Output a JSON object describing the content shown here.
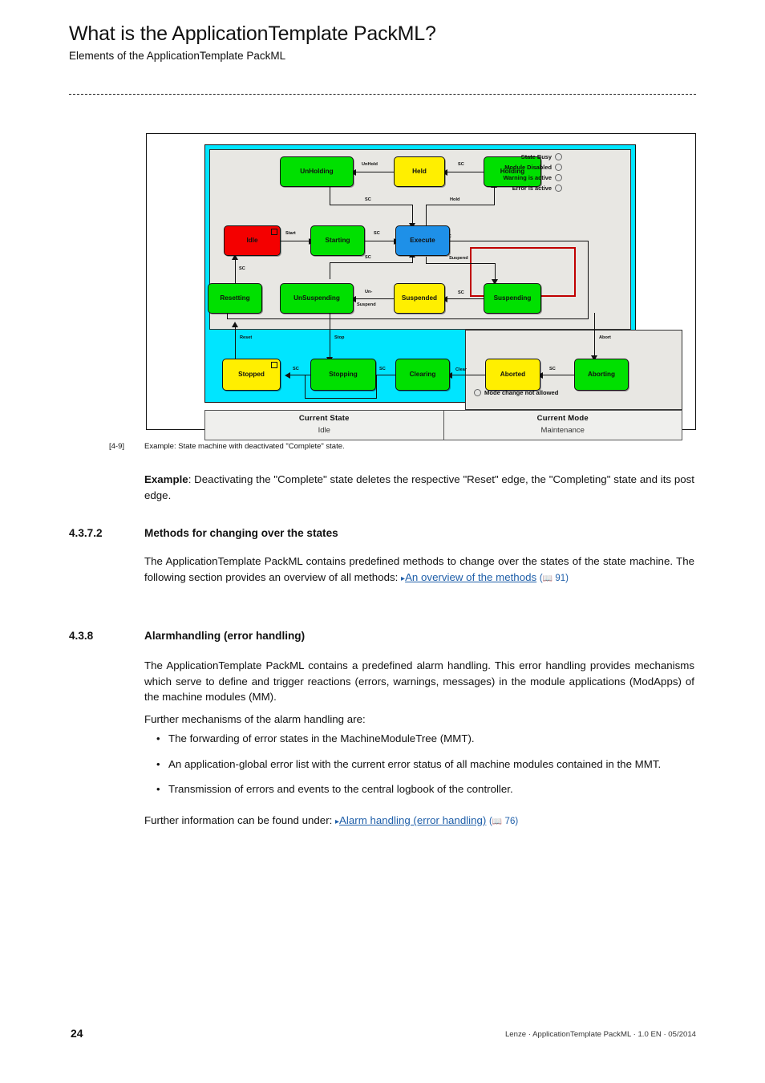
{
  "header": {
    "title": "What is the ApplicationTemplate PackML?",
    "subtitle": "Elements of the ApplicationTemplate PackML"
  },
  "figure": {
    "caption_number": "[4-9]",
    "caption_text": "Example: State machine with deactivated \"Complete\" state.",
    "states": [
      {
        "id": "unholding",
        "label": "UnHolding",
        "color": "#00e000",
        "color_name": "green"
      },
      {
        "id": "held",
        "label": "Held",
        "color": "#ffef00",
        "color_name": "yellow"
      },
      {
        "id": "holding",
        "label": "Holding",
        "color": "#00e000",
        "color_name": "green"
      },
      {
        "id": "idle",
        "label": "Idle",
        "color": "#f40000",
        "color_name": "red"
      },
      {
        "id": "starting",
        "label": "Starting",
        "color": "#00e000",
        "color_name": "green"
      },
      {
        "id": "execute",
        "label": "Execute",
        "color": "#1e90e8",
        "color_name": "blue"
      },
      {
        "id": "resetting",
        "label": "Resetting",
        "color": "#00e000",
        "color_name": "green"
      },
      {
        "id": "unsuspending",
        "label": "UnSuspending",
        "color": "#00e000",
        "color_name": "green"
      },
      {
        "id": "suspended",
        "label": "Suspended",
        "color": "#ffef00",
        "color_name": "yellow"
      },
      {
        "id": "suspending",
        "label": "Suspending",
        "color": "#00e000",
        "color_name": "green"
      },
      {
        "id": "stopped",
        "label": "Stopped",
        "color": "#ffef00",
        "color_name": "yellow"
      },
      {
        "id": "stopping",
        "label": "Stopping",
        "color": "#00e000",
        "color_name": "green"
      },
      {
        "id": "clearing",
        "label": "Clearing",
        "color": "#00e000",
        "color_name": "green"
      },
      {
        "id": "aborted",
        "label": "Aborted",
        "color": "#ffef00",
        "color_name": "yellow"
      },
      {
        "id": "aborting",
        "label": "Aborting",
        "color": "#00e000",
        "color_name": "green"
      }
    ],
    "transition_labels": {
      "unhold": "UnHold",
      "sc_held_holding": "SC",
      "sc_unholding_execute": "SC",
      "hold": "Hold",
      "start": "Start",
      "sc_starting_execute": "SC",
      "sc_execute_right": "SC",
      "sc_resetting_idle": "SC",
      "sc_unsuspending_execute": "SC",
      "suspend": "Suspend",
      "un_suspend_1": "Un-",
      "un_suspend_2": "Suspend",
      "sc_suspending_suspended": "SC",
      "reset": "Reset",
      "stop": "Stop",
      "sc_stopping_stopped": "SC",
      "sc_clearing_stopping": "SC",
      "clear": "Clear",
      "sc_aborting_aborted": "SC",
      "abort": "Abort"
    },
    "lamps": [
      {
        "label": "State Busy"
      },
      {
        "label": "Module Disabled"
      },
      {
        "label": "Warning is active"
      },
      {
        "label": "Error is active"
      }
    ],
    "mode_change_label": "Mode change not allowed",
    "status_table": [
      {
        "head": "Current State",
        "value": "Idle"
      },
      {
        "head": "Current Mode",
        "value": "Maintenance"
      }
    ],
    "colors": {
      "cyan_panel": "#00e5ff",
      "grey_region": "#e8e7e3",
      "red_annotation": "#c00000"
    }
  },
  "body": {
    "example_label": "Example",
    "example_text": ": Deactivating the \"Complete\" state deletes the respective \"Reset\" edge, the \"Completing\" state and its post edge."
  },
  "section_methods": {
    "number": "4.3.7.2",
    "title": "Methods for changing over the states",
    "para_1": "The ApplicationTemplate PackML contains predefined methods to change over the states of the state machine. The following section provides an overview of all methods: ",
    "link_text": "An overview of the methods",
    "page_ref": "91"
  },
  "section_alarm": {
    "number": "4.3.8",
    "title": "Alarmhandling (error handling)",
    "para_1": "The ApplicationTemplate PackML contains a predefined alarm handling. This error handling provides mechanisms which serve to define and trigger reactions (errors, warnings, messages) in the module applications (ModApps) of the machine modules (MM).",
    "para_2": "Further mechanisms of the alarm handling are:",
    "bullets": [
      "The forwarding of error states in the MachineModuleTree (MMT).",
      "An application-global error list with the current error status of all machine modules contained in the MMT.",
      "Transmission of errors and events to the central logbook of the controller."
    ],
    "para_3": "Further information can be found under: ",
    "link_text": "Alarm handling (error handling)",
    "page_ref": "76"
  },
  "footer": {
    "page_number": "24",
    "text": "Lenze · ApplicationTemplate PackML · 1.0 EN · 05/2014"
  }
}
